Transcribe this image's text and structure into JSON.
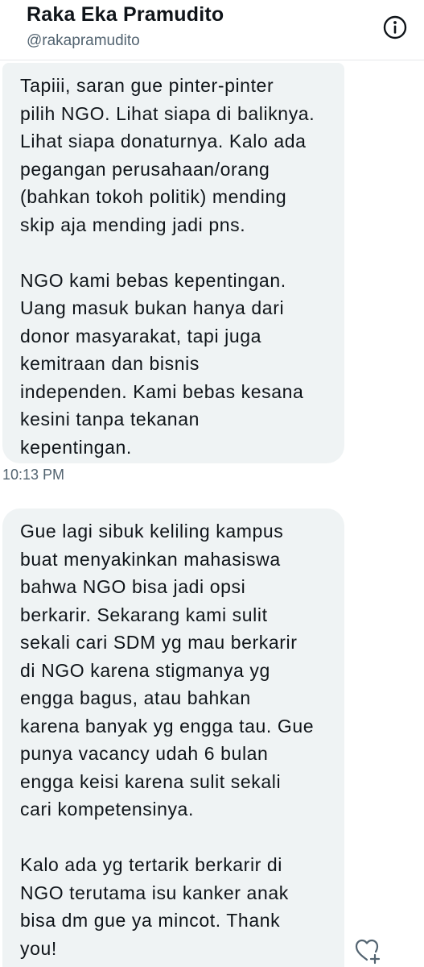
{
  "header": {
    "name": "Raka Eka Pramudito",
    "handle": "@rakapramudito",
    "info_icon": "info-icon"
  },
  "messages": [
    {
      "lines": [
        "Tapiii, saran gue pinter-pinter",
        "pilih NGO. Lihat siapa di baliknya.",
        "Lihat siapa donaturnya. Kalo ada",
        "pegangan perusahaan/orang",
        "(bahkan tokoh politik) mending",
        "skip aja mending jadi pns.",
        "",
        "NGO kami bebas kepentingan.",
        "Uang masuk bukan hanya dari",
        "donor masyarakat, tapi juga",
        "kemitraan dan bisnis",
        "independen. Kami bebas kesana",
        "kesini tanpa tekanan",
        "kepentingan."
      ],
      "timestamp": "10:13 PM"
    },
    {
      "lines": [
        "Gue lagi sibuk keliling kampus",
        "buat menyakinkan mahasiswa",
        "bahwa NGO bisa jadi opsi",
        "berkarir. Sekarang kami sulit",
        "sekali cari SDM yg mau berkarir",
        "di NGO karena stigmanya yg",
        "engga bagus, atau bahkan",
        "karena banyak yg engga tau. Gue",
        "punya vacancy udah 6 bulan",
        "engga keisi karena sulit sekali",
        "cari kompetensinya.",
        "",
        "Kalo ada yg tertarik berkarir di",
        "NGO terutama isu kanker anak",
        "bisa dm gue ya mincot. Thank",
        "you!"
      ],
      "reaction_icon": "add-reaction-heart-icon"
    }
  ],
  "colors": {
    "bubble_bg": "#eff3f4",
    "text": "#0f1419",
    "secondary_text": "#536471"
  }
}
